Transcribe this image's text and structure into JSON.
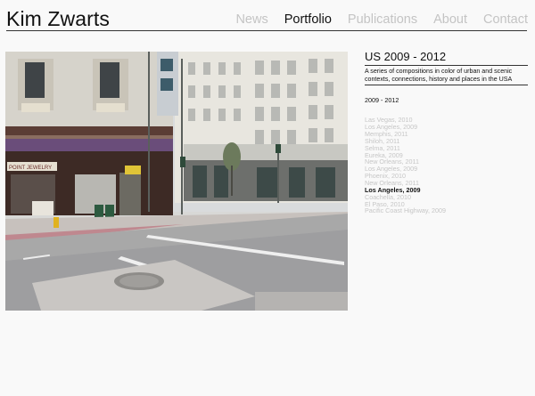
{
  "site": {
    "title": "Kim Zwarts"
  },
  "nav": {
    "items": [
      {
        "label": "News",
        "active": false
      },
      {
        "label": "Portfolio",
        "active": true
      },
      {
        "label": "Publications",
        "active": false
      },
      {
        "label": "About",
        "active": false
      },
      {
        "label": "Contact",
        "active": false
      }
    ]
  },
  "series": {
    "title": "US 2009 - 2012",
    "description": "A series of compositions in color of urban and scenic contexts, connections, history and places in the USA",
    "years": "2009 - 2012",
    "items": [
      {
        "label": "Las Vegas, 2010",
        "active": false
      },
      {
        "label": "Los Angeles, 2009",
        "active": false
      },
      {
        "label": "Memphis, 2011",
        "active": false
      },
      {
        "label": "Shiloh, 2011",
        "active": false
      },
      {
        "label": "Selma, 2011",
        "active": false
      },
      {
        "label": "Eureka, 2009",
        "active": false
      },
      {
        "label": "New Orleans, 2011",
        "active": false
      },
      {
        "label": "Los Angeles, 2009",
        "active": false
      },
      {
        "label": "Phoenix, 2010",
        "active": false
      },
      {
        "label": "New Orleans, 2011",
        "active": false
      },
      {
        "label": "Los Angeles, 2009",
        "active": true
      },
      {
        "label": "Coachella, 2010",
        "active": false
      },
      {
        "label": "El Paso, 2010",
        "active": false
      },
      {
        "label": "Pacific Coast Highway, 2009",
        "active": false
      }
    ]
  },
  "photo": {
    "storefront_sign": "POINT JEWELRY"
  },
  "colors": {
    "text": "#111111",
    "muted": "#c4c4c4",
    "background": "#f9f9f9"
  }
}
